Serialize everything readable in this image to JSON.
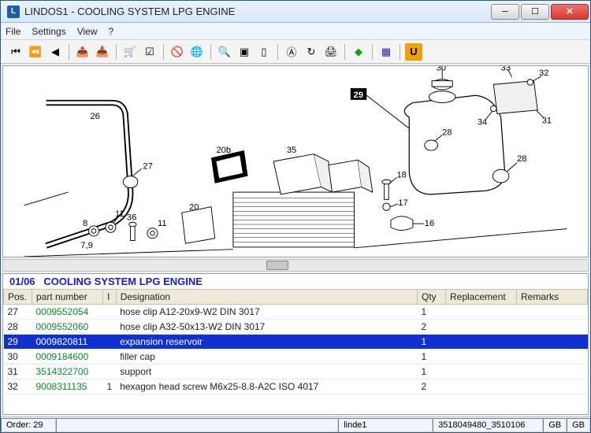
{
  "window": {
    "title": "LINDOS1 - COOLING SYSTEM LPG ENGINE",
    "icon_letter": "L"
  },
  "menubar": [
    "File",
    "Settings",
    "View",
    "?"
  ],
  "parts_header": {
    "page": "01/06",
    "title": "COOLING SYSTEM LPG ENGINE"
  },
  "columns": [
    "Pos.",
    "part number",
    "I",
    "Designation",
    "Qty",
    "Replacement",
    "Remarks"
  ],
  "rows": [
    {
      "pos": "27",
      "pn": "0009552054",
      "i": "",
      "desig": "hose clip A12-20x9-W2  DIN 3017",
      "qty": "1",
      "repl": "",
      "rem": "",
      "sel": false
    },
    {
      "pos": "28",
      "pn": "0009552060",
      "i": "",
      "desig": "hose clip A32-50x13-W2  DIN 3017",
      "qty": "2",
      "repl": "",
      "rem": "",
      "sel": false
    },
    {
      "pos": "29",
      "pn": "0009820811",
      "i": "",
      "desig": "expansion reservoir",
      "qty": "1",
      "repl": "",
      "rem": "",
      "sel": true
    },
    {
      "pos": "30",
      "pn": "0009184600",
      "i": "",
      "desig": "filler cap",
      "qty": "1",
      "repl": "",
      "rem": "",
      "sel": false
    },
    {
      "pos": "31",
      "pn": "3514322700",
      "i": "",
      "desig": "support",
      "qty": "1",
      "repl": "",
      "rem": "",
      "sel": false
    },
    {
      "pos": "32",
      "pn": "9008311135",
      "i": "1",
      "desig": "hexagon head screw M6x25-8.8-A2C  ISO 4017",
      "qty": "2",
      "repl": "",
      "rem": "",
      "sel": false
    }
  ],
  "statusbar": {
    "order_label": "Order:",
    "order_value": "29",
    "user": "linde1",
    "code": "3518049480_3510106",
    "lang1": "GB",
    "lang2": "GB"
  },
  "callouts": {
    "c26": "26",
    "c20b": "20b",
    "c35": "35",
    "c29": "29",
    "c30": "30",
    "c33": "33",
    "c32": "32",
    "c31": "31",
    "c34": "34",
    "c28": "28",
    "c28b": "28",
    "c27": "27",
    "c18": "18",
    "c17": "17",
    "c16": "16",
    "c11": "11",
    "c8": "8",
    "c36": "36",
    "c20": "20",
    "c11b": "11",
    "c79": "7,9"
  }
}
